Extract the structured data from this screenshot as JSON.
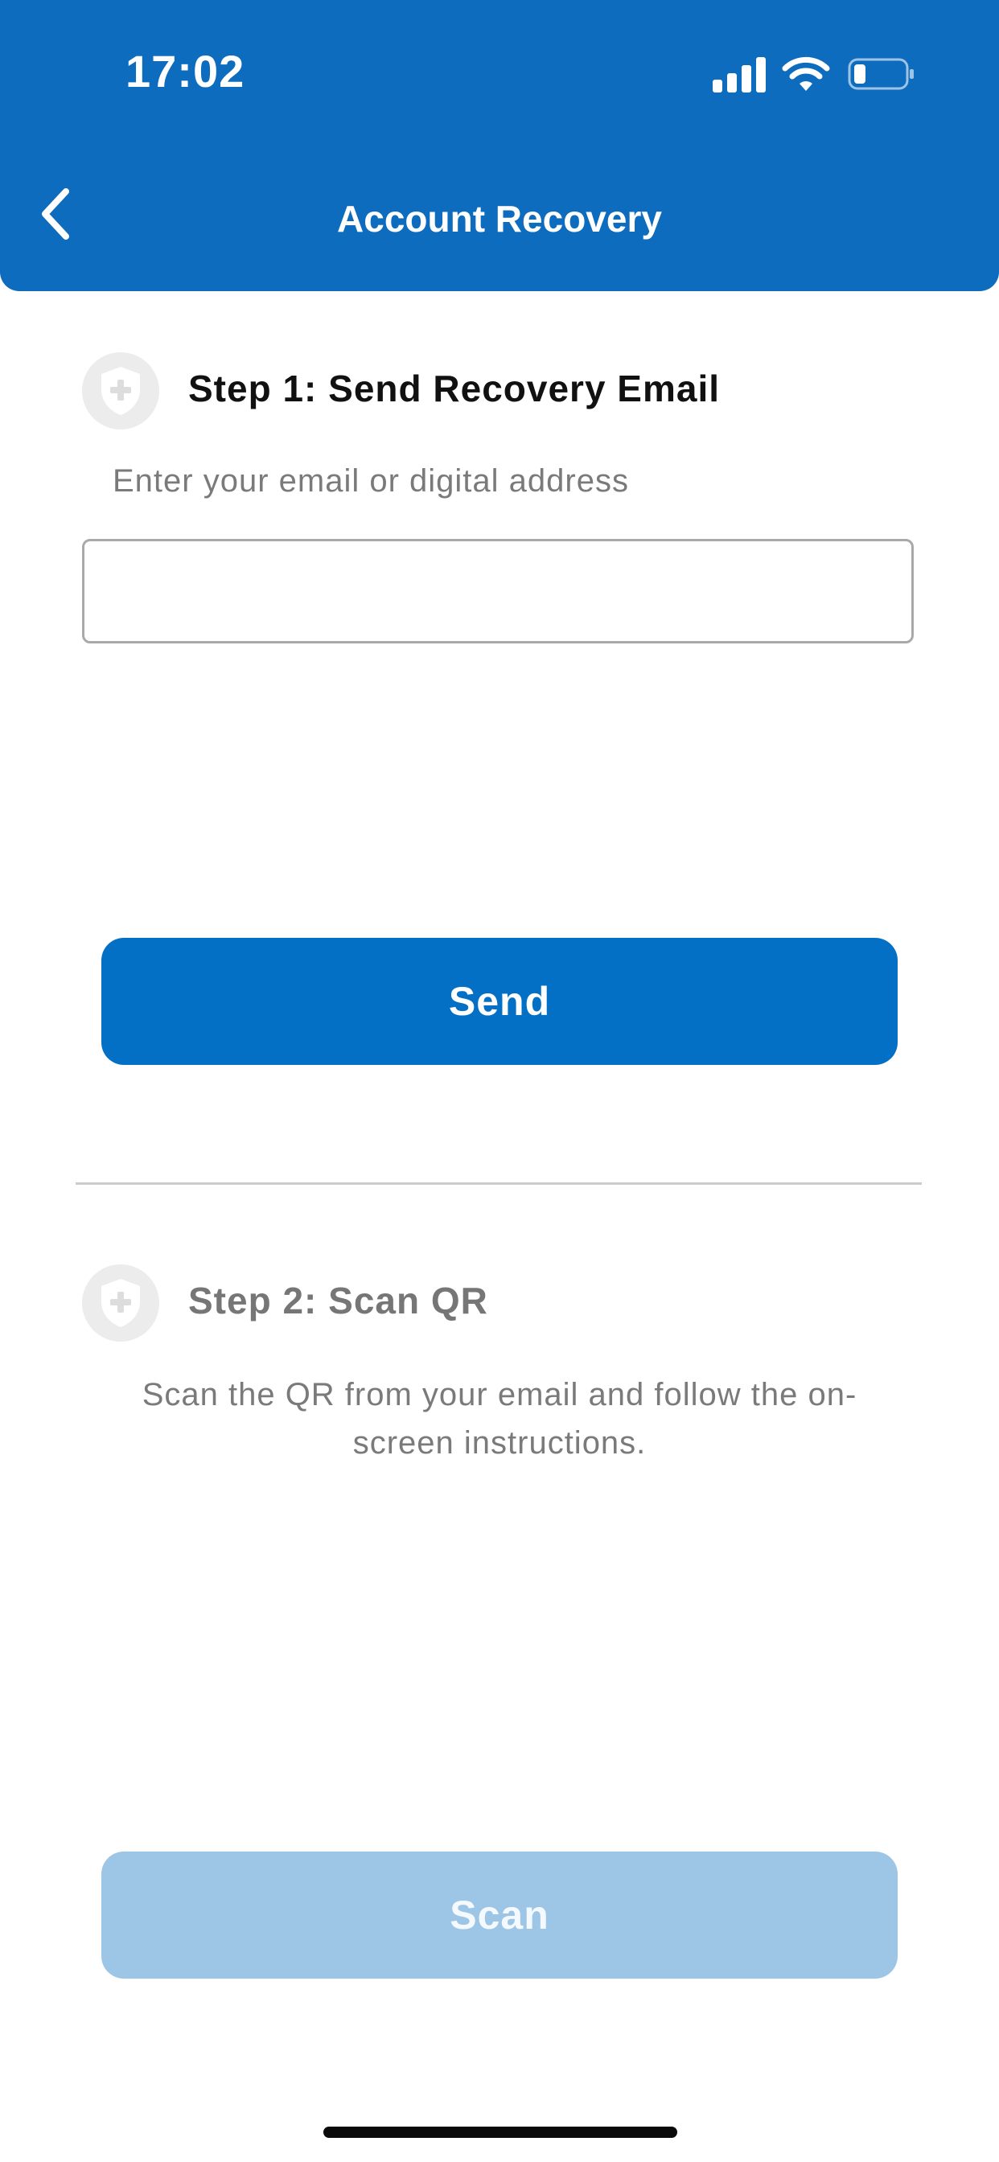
{
  "status_bar": {
    "time": "17:02"
  },
  "header": {
    "title": "Account Recovery"
  },
  "icons": {
    "back": "chevron-left-icon",
    "step": "shield-plus-icon",
    "signal": "cellular-signal-icon",
    "wifi": "wifi-icon",
    "battery": "battery-low-icon"
  },
  "step1": {
    "title": "Step 1: Send Recovery Email",
    "label": "Enter your email or digital address",
    "input_value": "",
    "input_placeholder": "",
    "button_label": "Send"
  },
  "step2": {
    "title": "Step 2: Scan QR",
    "description": "Scan the QR from your email and follow the on-screen instructions.",
    "button_label": "Scan",
    "button_state": "disabled"
  },
  "colors": {
    "header": "#0d6cbd",
    "primary_button": "#0470c5",
    "disabled_button": "#9dc6e6",
    "muted_text": "#7a7a7a",
    "step_icon_bg": "#ececec"
  }
}
